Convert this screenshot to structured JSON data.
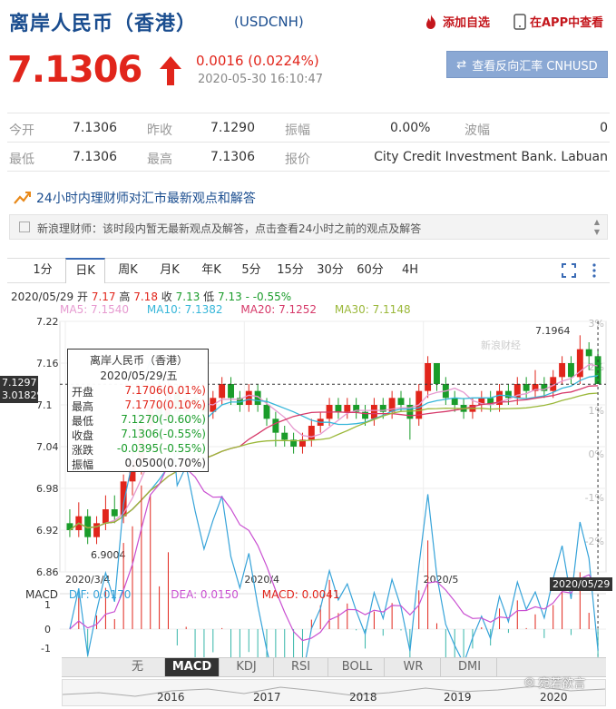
{
  "header": {
    "title": "离岸人民币（香港）",
    "code": "(USDCNH)",
    "fav_label": "添加自选",
    "app_label": "在APP中查看"
  },
  "quote": {
    "price": "7.1306",
    "change": "0.0016 (0.0224%)",
    "time": "2020-05-30 16:10:47",
    "reverse_label": "查看反向汇率 CNHUSD"
  },
  "stats": {
    "row1": [
      {
        "label": "今开",
        "value": "7.1306"
      },
      {
        "label": "昨收",
        "value": "7.1290"
      },
      {
        "label": "振幅",
        "value": "0.00%"
      },
      {
        "label": "波幅",
        "value": "0"
      }
    ],
    "row2": [
      {
        "label": "最低",
        "value": "7.1306"
      },
      {
        "label": "最高",
        "value": "7.1306"
      },
      {
        "label": "报价",
        "value": "City Credit Investment Bank. Labuan"
      }
    ]
  },
  "news": {
    "heading": "24小时内理财师对汇市最新观点和解答",
    "item": "新浪理财师：该时段内暂无最新观点及解答，点击查看24小时之前的观点及解答"
  },
  "tabs": [
    "1分",
    "日K",
    "周K",
    "月K",
    "年K",
    "5分",
    "15分",
    "30分",
    "60分",
    "4H"
  ],
  "chart_info": {
    "ohlc": {
      "date": "2020/05/29",
      "open_label": "开",
      "open": "7.17",
      "high_label": "高",
      "high": "7.18",
      "close_label": "收",
      "close": "7.13",
      "low_label": "低",
      "low": "7.13",
      "chg": "- -0.55%"
    },
    "ma": [
      {
        "label": "MA5: 7.1540",
        "color": "#e69ad0"
      },
      {
        "label": "MA10: 7.1382",
        "color": "#36b6d9"
      },
      {
        "label": "MA20: 7.1252",
        "color": "#d63a6a"
      },
      {
        "label": "MA30: 7.1148",
        "color": "#9bb83a"
      }
    ],
    "cursor_price": "7.1297",
    "cursor_pct": "3.0182%",
    "cursor_date": "2020/05/29",
    "watermark": "新浪财经"
  },
  "tooltip": {
    "title": "离岸人民币（香港）",
    "date": "2020/05/29/五",
    "rows": [
      {
        "k": "开盘",
        "v": "7.1706(0.01%)",
        "color": "#e1251b"
      },
      {
        "k": "最高",
        "v": "7.1770(0.10%)",
        "color": "#e1251b"
      },
      {
        "k": "最低",
        "v": "7.1270(-0.60%)",
        "color": "#1a9c2a"
      },
      {
        "k": "收盘",
        "v": "7.1306(-0.55%)",
        "color": "#1a9c2a"
      },
      {
        "k": "涨跌",
        "v": "-0.0395(-0.55%)",
        "color": "#1a9c2a"
      },
      {
        "k": "振幅",
        "v": "0.0500(0.70%)",
        "color": "#333"
      }
    ]
  },
  "chart_data": {
    "type": "candlestick",
    "y_ticks": [
      "7.22",
      "7.16",
      "7.1",
      "7.04",
      "6.98",
      "6.92",
      "6.86"
    ],
    "pct_ticks": [
      "3%",
      "2%",
      "1%",
      "0%",
      "-1%",
      "-2%"
    ],
    "ylim": [
      6.86,
      7.22
    ],
    "x_ticks": [
      "2020/3/4",
      "2020/4",
      "2020/5"
    ],
    "annotations": [
      {
        "label": "7.1964",
        "value": 7.1964
      },
      {
        "label": "6.9004",
        "value": 6.9004
      }
    ],
    "candles": [
      [
        6.93,
        6.92,
        6.95,
        6.91
      ],
      [
        6.92,
        6.94,
        6.96,
        6.91
      ],
      [
        6.94,
        6.91,
        6.95,
        6.9
      ],
      [
        6.91,
        6.93,
        6.94,
        6.9
      ],
      [
        6.93,
        6.95,
        6.97,
        6.92
      ],
      [
        6.95,
        6.94,
        6.97,
        6.93
      ],
      [
        6.94,
        6.99,
        7.0,
        6.93
      ],
      [
        6.99,
        7.02,
        7.04,
        6.97
      ],
      [
        7.02,
        7.07,
        7.08,
        7.0
      ],
      [
        7.07,
        7.1,
        7.12,
        7.05
      ],
      [
        7.1,
        7.08,
        7.14,
        7.06
      ],
      [
        7.08,
        7.12,
        7.14,
        7.07
      ],
      [
        7.12,
        7.09,
        7.13,
        7.08
      ],
      [
        7.09,
        7.11,
        7.12,
        7.08
      ],
      [
        7.11,
        7.1,
        7.12,
        7.09
      ],
      [
        7.1,
        7.09,
        7.11,
        7.08
      ],
      [
        7.09,
        7.11,
        7.12,
        7.08
      ],
      [
        7.11,
        7.13,
        7.14,
        7.1
      ],
      [
        7.13,
        7.11,
        7.14,
        7.1
      ],
      [
        7.11,
        7.1,
        7.12,
        7.09
      ],
      [
        7.1,
        7.12,
        7.13,
        7.09
      ],
      [
        7.12,
        7.1,
        7.13,
        7.09
      ],
      [
        7.1,
        7.08,
        7.11,
        7.07
      ],
      [
        7.08,
        7.06,
        7.09,
        7.04
      ],
      [
        7.06,
        7.05,
        7.07,
        7.04
      ],
      [
        7.05,
        7.04,
        7.06,
        7.03
      ],
      [
        7.04,
        7.05,
        7.06,
        7.03
      ],
      [
        7.05,
        7.07,
        7.08,
        7.04
      ],
      [
        7.07,
        7.08,
        7.09,
        7.06
      ],
      [
        7.08,
        7.1,
        7.11,
        7.07
      ],
      [
        7.1,
        7.09,
        7.11,
        7.08
      ],
      [
        7.09,
        7.1,
        7.11,
        7.08
      ],
      [
        7.1,
        7.09,
        7.11,
        7.08
      ],
      [
        7.09,
        7.08,
        7.1,
        7.07
      ],
      [
        7.08,
        7.1,
        7.11,
        7.07
      ],
      [
        7.1,
        7.09,
        7.11,
        7.08
      ],
      [
        7.09,
        7.11,
        7.12,
        7.08
      ],
      [
        7.11,
        7.1,
        7.12,
        7.09
      ],
      [
        7.1,
        7.08,
        7.11,
        7.05
      ],
      [
        7.08,
        7.12,
        7.13,
        7.07
      ],
      [
        7.12,
        7.16,
        7.17,
        7.11
      ],
      [
        7.16,
        7.13,
        7.16,
        7.12
      ],
      [
        7.13,
        7.11,
        7.14,
        7.1
      ],
      [
        7.11,
        7.1,
        7.12,
        7.09
      ],
      [
        7.1,
        7.09,
        7.11,
        7.08
      ],
      [
        7.09,
        7.1,
        7.11,
        7.08
      ],
      [
        7.1,
        7.11,
        7.12,
        7.09
      ],
      [
        7.11,
        7.1,
        7.12,
        7.09
      ],
      [
        7.1,
        7.12,
        7.13,
        7.09
      ],
      [
        7.12,
        7.11,
        7.13,
        7.1
      ],
      [
        7.11,
        7.13,
        7.14,
        7.1
      ],
      [
        7.13,
        7.12,
        7.14,
        7.11
      ],
      [
        7.12,
        7.13,
        7.15,
        7.11
      ],
      [
        7.13,
        7.12,
        7.14,
        7.11
      ],
      [
        7.12,
        7.14,
        7.15,
        7.11
      ],
      [
        7.14,
        7.16,
        7.17,
        7.13
      ],
      [
        7.16,
        7.14,
        7.17,
        7.13
      ],
      [
        7.14,
        7.18,
        7.2,
        7.13
      ],
      [
        7.18,
        7.17,
        7.19,
        7.15
      ],
      [
        7.17,
        7.13,
        7.18,
        7.13
      ]
    ],
    "macd": {
      "label": "MACD",
      "dif": "DIF: 0.0170",
      "dea": "DEA: 0.0150",
      "macd": "MACD: 0.0041",
      "y_ticks": [
        "1",
        "0",
        "-1"
      ]
    }
  },
  "bottom": {
    "indicators": [
      "无",
      "MACD",
      "KDJ",
      "RSI",
      "BOLL",
      "WR",
      "DMI"
    ],
    "active": "MACD",
    "years": [
      "2016",
      "2017",
      "2018",
      "2019",
      "2020"
    ],
    "watermark": "宛若欲言"
  }
}
